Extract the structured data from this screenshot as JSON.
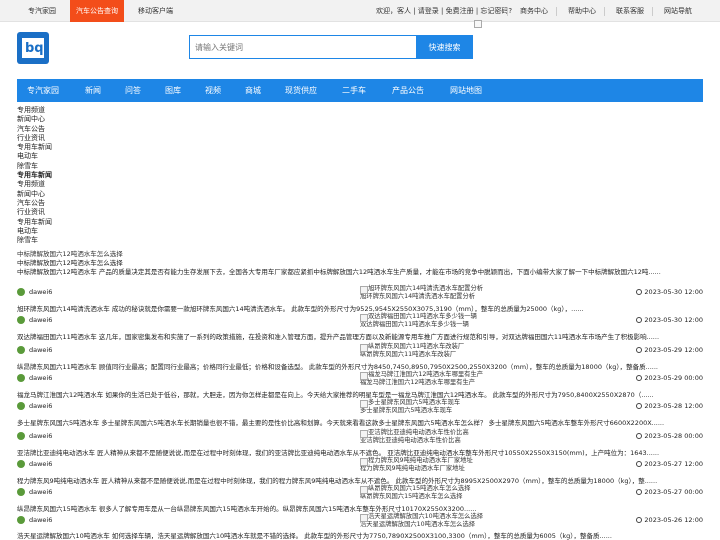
{
  "topbar": {
    "tabs": [
      "专汽家园",
      "汽车公告查询",
      "移动客户端"
    ],
    "login_text": "欢迎，客人 | 请登录 | 免费注册 | 忘记密码?",
    "links": [
      "商务中心",
      "帮助中心",
      "联系客服",
      "网站导航"
    ]
  },
  "search": {
    "placeholder": "请输入关键词",
    "button": "快速搜索"
  },
  "nav": [
    "专汽家园",
    "新闻",
    "问答",
    "图库",
    "视频",
    "商城",
    "现货供应",
    "二手车",
    "产品公告",
    "网站地图"
  ],
  "sidebar": [
    "专用频道",
    "新闻中心",
    "汽车公告",
    "行业资讯",
    "专用车新闻",
    "电动车",
    "除雪车",
    "专用车新闻",
    "专用频道",
    "新闻中心",
    "汽车公告",
    "行业资讯",
    "专用车新闻",
    "电动车",
    "除雪车"
  ],
  "featured": {
    "img_alt": "中标牌解放国六12吨洒水车怎么选择",
    "title": "中标牌解放国六12吨洒水车怎么选择",
    "desc": "中标牌解放国六12吨洒水车 产品的质量决定其是否有能力生存发展下去，全国各大专用车厂家都应紧抓中标牌解放国六12吨洒水车生产质量，才能在市场的竞争中脱颖而出，下面小编带大家了解一下中标牌解放国六12吨......"
  },
  "articles": [
    {
      "author": "dawei6",
      "img_alt": "旭环牌东风国六14吨清洗洒水车配置分析",
      "caption": "旭环牌东风国六14吨清洗洒水车配置分析",
      "date": "2023-05-30 12:00",
      "summary": "旭环牌东风国六14吨清洗洒水车 成功的秘诀就是你需要一款旭环牌东风国六14吨清洗洒水车。 此款车型的外形尺寸为9525,9545X2550X3075,3190（mm），整车的总质量为25000（kg），......"
    },
    {
      "author": "dawei6",
      "img_alt": "双达牌福田国六11吨洒水车多少钱一辆",
      "caption": "双达牌福田国六11吨洒水车多少钱一辆",
      "date": "2023-05-30 12:00",
      "summary": "双达牌福田国六11吨洒水车 这几年，国家密集发布和实施了一系列的政策措施，在投资和准入管理方面，提升产品管理方面以及新能源专用车推广方面进行规范和引导，对双达牌福田国六11吨洒水车市场产生了积极影响......"
    },
    {
      "author": "dawei6",
      "img_alt": "纵昂牌东风国六11吨洒水车改装厂",
      "caption": "纵昂牌东风国六11吨洒水车改装厂",
      "date": "2023-05-29 12:00",
      "summary": "纵昂牌东风国六11吨洒水车 顾值同行业最高；配置同行业最高；价格同行业最低；价格和设备选型。 此款车型的外形尺寸为8450,7450,8950,7950X2500,2550X3200（mm），整车的总质量为18000（kg），整备质......"
    },
    {
      "author": "dawei6",
      "img_alt": "福龙马牌江淮国六12吨洒水车哪里有生产",
      "caption": "福龙马牌江淮国六12吨洒水车哪里有生产",
      "date": "2023-05-29 00:00",
      "summary": "福龙马牌江淮国六12吨洒水车 如果你的生活已处于低谷，那就，大胆走，因为你怎样走都是在向上。今天给大家推荐的明星车型是一福龙马牌江淮国六12吨洒水车。 此款车型的外形尺寸为7950,8400X2550X2870（......"
    },
    {
      "author": "dawei6",
      "img_alt": "多士星牌东风国六5吨洒水车现车",
      "caption": "多士星牌东风国六5吨洒水车现车",
      "date": "2023-05-28 12:00",
      "summary": "多士星牌东风国六5吨洒水车 多士星牌东风国六5吨洒水车长期销量也很不错，最主要的是性价比高和划算。今天就来看看这款多士星牌东风国六5吨洒水车怎么样？ 多士星牌东风国六5吨洒水车整车外形尺寸6600X2200X......"
    },
    {
      "author": "dawei6",
      "img_alt": "亚洁牌比亚迪纯电动洒水车性价比高",
      "caption": "亚洁牌比亚迪纯电动洒水车性价比高",
      "date": "2023-05-28 00:00",
      "summary": "亚洁牌比亚迪纯电动洒水车 匠人精神从来都不是随便说说,而是在过程中时刻体现，我们的亚洁牌比亚迪纯电动洒水车从不遮色。 亚洁牌比亚迪纯电动洒水车整车外形尺寸10550X2550X3150(mm)，上产吨位为：1643......"
    },
    {
      "author": "dawei6",
      "img_alt": "程力牌东风9吨纯电动洒水车厂家地址",
      "caption": "程力牌东风9吨纯电动洒水车厂家地址",
      "date": "2023-05-27 12:00",
      "summary": "程力牌东风9吨纯电动洒水车 匠人精神从来都不是随便说说,而是在过程中时刻体现，我们的程力牌东风9吨纯电动洒水车从不遮色。 此款车型的外形尺寸为8995X2500X2970（mm），整车的总质量为18000（kg），整......"
    },
    {
      "author": "dawei6",
      "img_alt": "纵昂牌东风国六15吨洒水车怎么选择",
      "caption": "纵昂牌东风国六15吨洒水车怎么选择",
      "date": "2023-05-27 00:00",
      "summary": "纵昂牌东风国六15吨洒水车 很多人了解专用车是从一台纵昂牌东风国六15吨洒水车开始的。纵昂牌东风国六15吨洒水车整车外形尺寸10170X2550X3200......"
    },
    {
      "author": "dawei6",
      "img_alt": "浩天星运牌解放国六10吨洒水车怎么选择",
      "caption": "浩天星运牌解放国六10吨洒水车怎么选择",
      "date": "2023-05-26 12:00",
      "summary": "浩天星运牌解放国六10吨洒水车 如何选择车辆，浩天星运牌解放国六10吨洒水车就是不错的选择。 此款车型的外形尺寸为7750,7890X2500X3100,3300（mm），整车的总质量为6005（kg），整备质......"
    }
  ]
}
